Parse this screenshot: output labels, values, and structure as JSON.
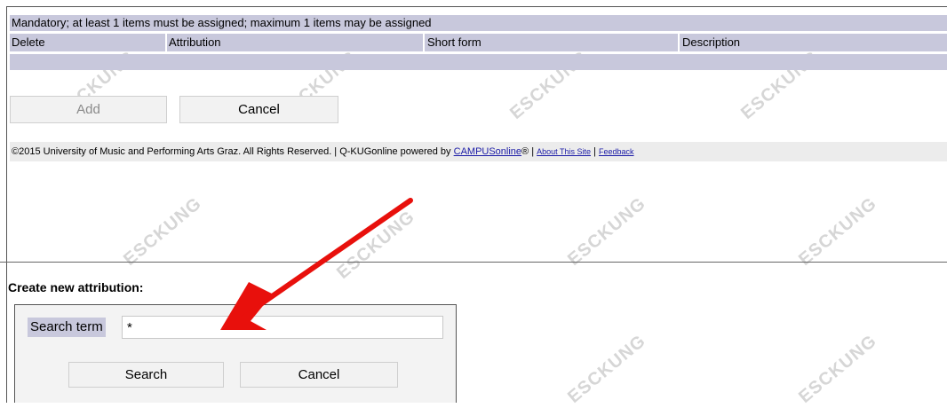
{
  "top_table": {
    "mandatory_note": "Mandatory; at least 1 items must be assigned; maximum 1 items may be assigned",
    "headers": [
      "Delete",
      "Attribution",
      "Short form",
      "Description"
    ]
  },
  "buttons": {
    "add": "Add",
    "cancel_top": "Cancel",
    "search": "Search",
    "cancel_bottom": "Cancel"
  },
  "footer": {
    "copyright": "©2015 University of Music and Performing Arts Graz. All Rights Reserved. | Q-KUGonline powered by ",
    "campus_link": "CAMPUSonline",
    "reg": "® | ",
    "about_link": "About This Site",
    "sep": " | ",
    "feedback_link": "Feedback"
  },
  "create_section": {
    "title": "Create new attribution:",
    "search_label": "Search term",
    "search_value": "*"
  },
  "watermark_text": "ESCKUNG",
  "colors": {
    "header_bg": "#c8c8dc",
    "arrow": "#e8100c",
    "link": "#1a1aa6"
  }
}
